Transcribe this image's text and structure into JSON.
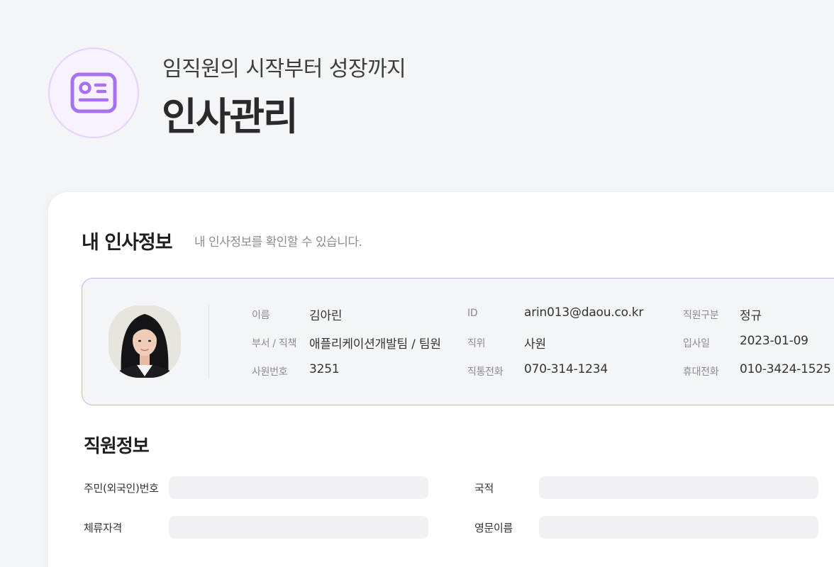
{
  "hero": {
    "subtitle": "임직원의 시작부터 성장까지",
    "title": "인사관리",
    "icon": "id-card-icon",
    "accent_color": "#a772f0"
  },
  "section": {
    "title": "내 인사정보",
    "description": "내 인사정보를 확인할 수 있습니다."
  },
  "profile": {
    "fields": {
      "name": {
        "label": "이름",
        "value": "김아린"
      },
      "dept": {
        "label": "부서 / 직책",
        "value": "애플리케이션개발팀 / 팀원"
      },
      "emp_no": {
        "label": "사원번호",
        "value": "3251"
      },
      "id": {
        "label": "ID",
        "value": "arin013@daou.co.kr"
      },
      "position": {
        "label": "직위",
        "value": "사원"
      },
      "office_phone": {
        "label": "직통전화",
        "value": "070-314-1234"
      },
      "emp_type": {
        "label": "직원구분",
        "value": "정규"
      },
      "join_date": {
        "label": "입사일",
        "value": "2023-01-09"
      },
      "mobile": {
        "label": "휴대전화",
        "value": "010-3424-1525"
      }
    }
  },
  "employee_info": {
    "title": "직원정보",
    "fields": {
      "resident_no": {
        "label": "주민(외국인)번호",
        "value": ""
      },
      "nationality": {
        "label": "국적",
        "value": ""
      },
      "residence_status": {
        "label": "체류자격",
        "value": ""
      },
      "english_name": {
        "label": "영문이름",
        "value": ""
      }
    }
  }
}
